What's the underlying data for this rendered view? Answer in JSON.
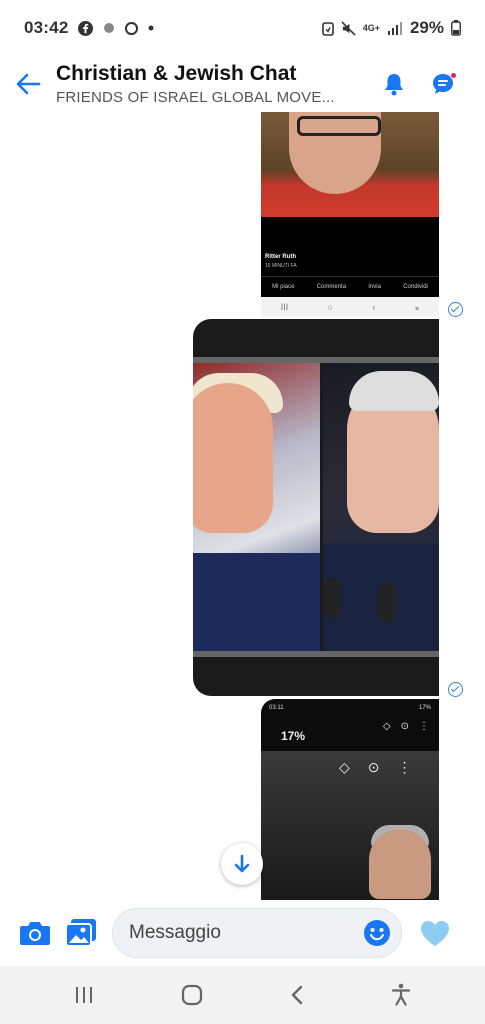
{
  "status_bar": {
    "time": "03:42",
    "battery": "29%",
    "network": "4G+",
    "left_icons": [
      "facebook-icon",
      "app-icon",
      "messenger-icon",
      "dot-icon"
    ],
    "right_icons": [
      "battery-saver-icon",
      "mute-icon",
      "network-icon",
      "signal-icon",
      "battery-icon"
    ]
  },
  "header": {
    "title": "Christian & Jewish Chat",
    "subtitle": "FRIENDS OF ISRAEL GLOBAL MOVE...",
    "has_notification_dot": true
  },
  "messages": [
    {
      "type": "screenshot",
      "poster_name": "Ritter Ruth",
      "time_ago": "16 MINUTI FA",
      "actions": [
        "Mi piace",
        "Commenta",
        "Invia",
        "Condividi"
      ],
      "status": "sent"
    },
    {
      "type": "image",
      "status": "sent"
    },
    {
      "type": "screenshot",
      "inner_time": "03:11",
      "inner_battery_small": "17%",
      "inner_battery_large": "17%"
    }
  ],
  "composer": {
    "placeholder": "Messaggio"
  },
  "colors": {
    "accent": "#1877f2",
    "check": "#3a80d2",
    "heart": "#8ecdf2",
    "nav_bg": "#f3f3f3"
  }
}
